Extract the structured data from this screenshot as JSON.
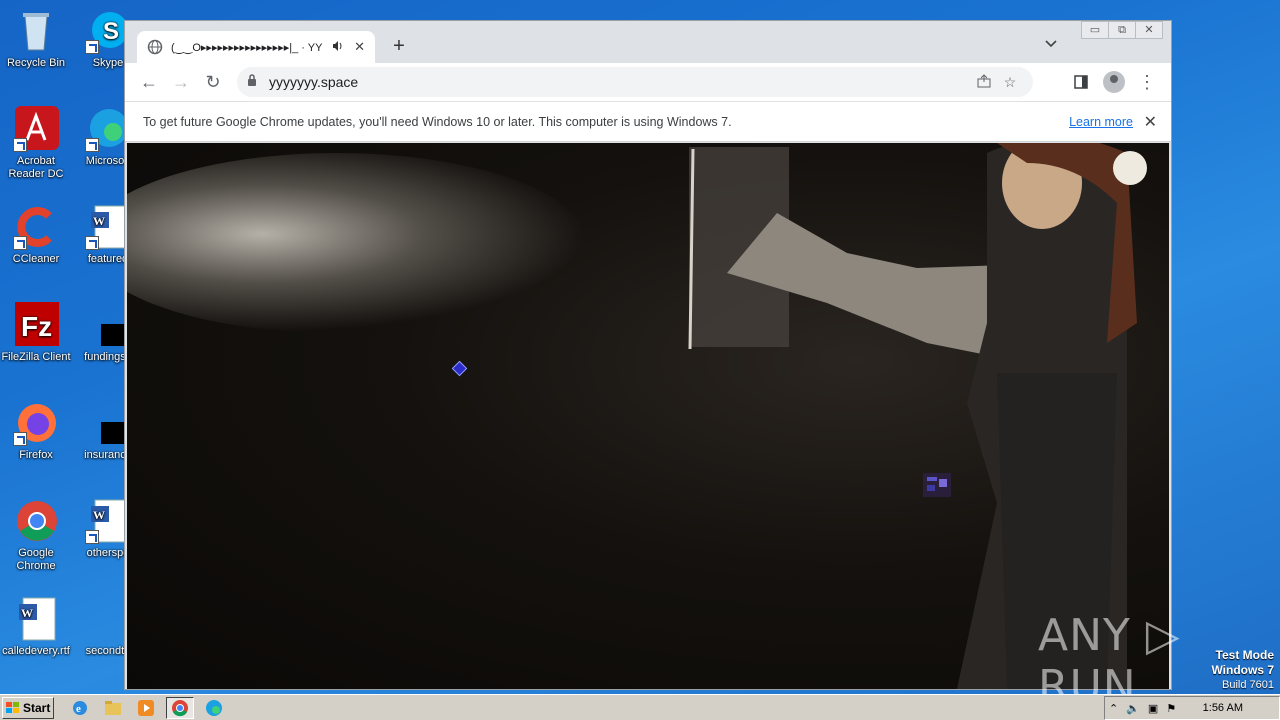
{
  "desktop": {
    "icons": [
      {
        "label": "Recycle Bin"
      },
      {
        "label": "Skype"
      },
      {
        "label": "Acrobat Reader DC"
      },
      {
        "label": "Microsoft"
      },
      {
        "label": "CCleaner"
      },
      {
        "label": "featured"
      },
      {
        "label": "FileZilla Client"
      },
      {
        "label": "fundingse"
      },
      {
        "label": "Firefox"
      },
      {
        "label": "insurance"
      },
      {
        "label": "Google Chrome"
      },
      {
        "label": "otherspo"
      },
      {
        "label": "calledevery.rtf"
      },
      {
        "label": "secondto"
      }
    ]
  },
  "chrome": {
    "tab": {
      "title": "(‿‿O▸▸▸▸▸▸▸▸▸▸▸▸▸▸▸▸|_ · YY",
      "audio_icon": "speaker-icon",
      "close_label": "✕"
    },
    "new_tab_label": "+",
    "window_controls": {
      "minimize": "▭",
      "restore": "⧉",
      "close": "✕"
    },
    "toolbar": {
      "url": "yyyyyyy.space",
      "back": "←",
      "forward": "→",
      "reload": "↻"
    },
    "infobar": {
      "message": "To get future Google Chrome updates, you'll need Windows 10 or later. This computer is using Windows 7.",
      "link": "Learn more",
      "close": "✕"
    }
  },
  "watermark": {
    "text": "ANY ▷ RUN"
  },
  "os_overlay": {
    "line1": "Test Mode",
    "line2": "Windows 7",
    "line3": "Build 7601"
  },
  "taskbar": {
    "start_label": "Start",
    "clock": "1:56 AM"
  },
  "colors": {
    "desktop_bg": "#1a73d1",
    "link": "#1a73e8",
    "taskbar": "#d4d0c8"
  }
}
